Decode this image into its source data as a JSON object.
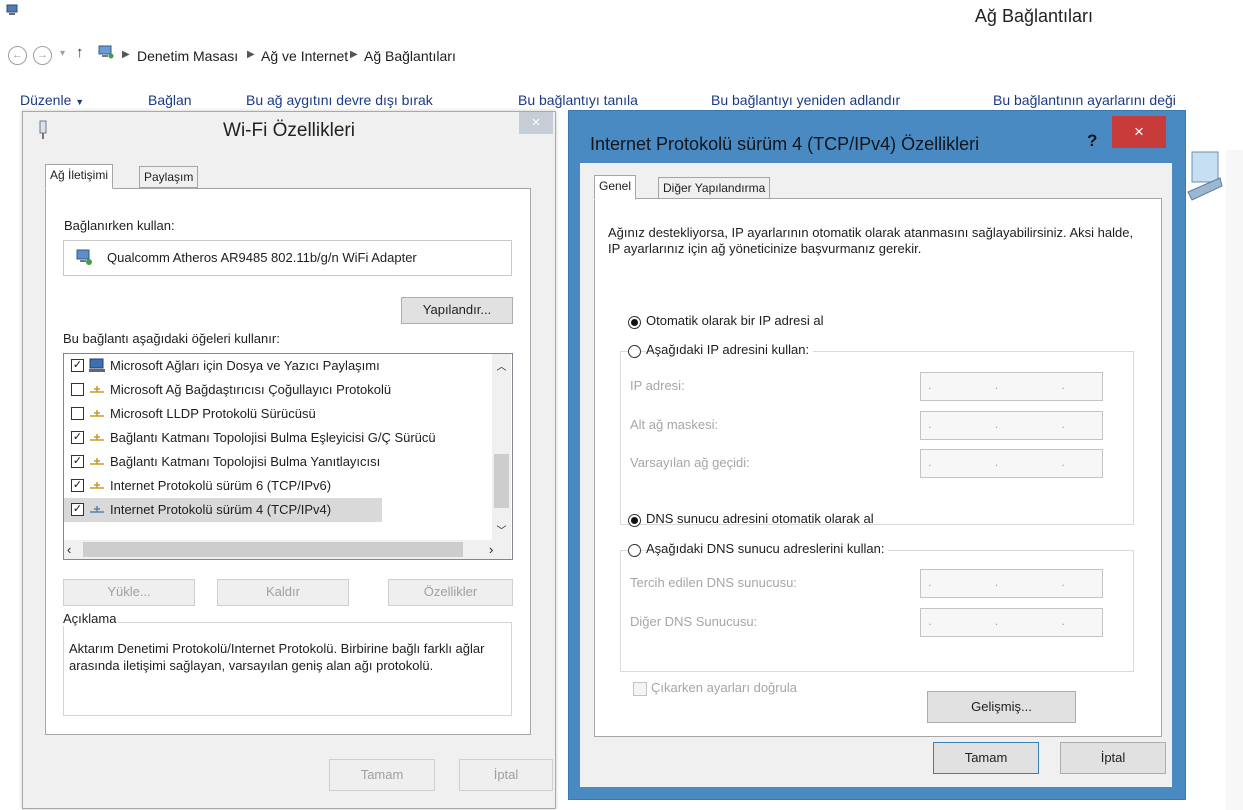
{
  "explorer": {
    "window_title": "Ağ Bağlantıları",
    "breadcrumb": [
      "Denetim Masası",
      "Ağ ve Internet",
      "Ağ Bağlantıları"
    ],
    "toolbar": {
      "arrange": "Düzenle",
      "connect": "Bağlan",
      "disable": "Bu ağ aygıtını devre dışı bırak",
      "diagnose": "Bu bağlantıyı tanıla",
      "rename": "Bu bağlantıyı yeniden adlandır",
      "settings": "Bu bağlantının ayarlarını deği"
    }
  },
  "wifi_dialog": {
    "title": "Wi-Fi Özellikleri",
    "close": "×",
    "tabs": [
      "Ağ İletişimi",
      "Paylaşım"
    ],
    "connect_using_label": "Bağlanırken kullan:",
    "adapter_name": "Qualcomm Atheros AR9485 802.11b/g/n WiFi Adapter",
    "configure": "Yapılandır...",
    "items_label": "Bu bağlantı aşağıdaki öğeleri kullanır:",
    "items": [
      {
        "label": "Microsoft Ağları için Dosya ve Yazıcı Paylaşımı",
        "checked": true
      },
      {
        "label": "Microsoft Ağ Bağdaştırıcısı Çoğullayıcı Protokolü",
        "checked": false
      },
      {
        "label": "Microsoft LLDP Protokolü Sürücüsü",
        "checked": false
      },
      {
        "label": "Bağlantı Katmanı Topolojisi Bulma Eşleyicisi G/Ç Sürücü",
        "checked": true
      },
      {
        "label": "Bağlantı Katmanı Topolojisi Bulma Yanıtlayıcısı",
        "checked": true
      },
      {
        "label": "Internet Protokolü sürüm 6 (TCP/IPv6)",
        "checked": true
      },
      {
        "label": "Internet Protokolü sürüm 4 (TCP/IPv4)",
        "checked": true
      }
    ],
    "install": "Yükle...",
    "uninstall": "Kaldır",
    "properties": "Özellikler",
    "description_title": "Açıklama",
    "description": "Aktarım Denetimi Protokolü/Internet Protokolü. Birbirine bağlı farklı ağlar arasında iletişimi sağlayan, varsayılan geniş alan ağı protokolü.",
    "ok": "Tamam",
    "cancel": "İptal"
  },
  "ipv4_dialog": {
    "title": "Internet Protokolü sürüm 4 (TCP/IPv4) Özellikleri",
    "help": "?",
    "close": "×",
    "tabs": [
      "Genel",
      "Diğer Yapılandırma"
    ],
    "intro": "Ağınız destekliyorsa, IP ayarlarının otomatik olarak atanmasını sağlayabilirsiniz. Aksi halde, IP ayarlarınız için ağ yöneticinize başvurmanız gerekir.",
    "ip_auto": "Otomatik olarak bir IP adresi al",
    "ip_manual": "Aşağıdaki IP adresini kullan:",
    "ip_address": "IP adresi:",
    "subnet": "Alt ağ maskesi:",
    "gateway": "Varsayılan ağ geçidi:",
    "dns_auto": "DNS sunucu adresini otomatik olarak al",
    "dns_manual": "Aşağıdaki DNS sunucu adreslerini kullan:",
    "dns_preferred": "Tercih edilen DNS sunucusu:",
    "dns_alternate": "Diğer DNS Sunucusu:",
    "ip_placeholder": ". . .",
    "validate_on_exit": "Çıkarken ayarları doğrula",
    "advanced": "Gelişmiş...",
    "ok": "Tamam",
    "cancel": "İptal"
  },
  "colors": {
    "dialog_border": "#4a8ac2",
    "close_red": "#c73c3a",
    "link_blue": "#1b3a86"
  }
}
